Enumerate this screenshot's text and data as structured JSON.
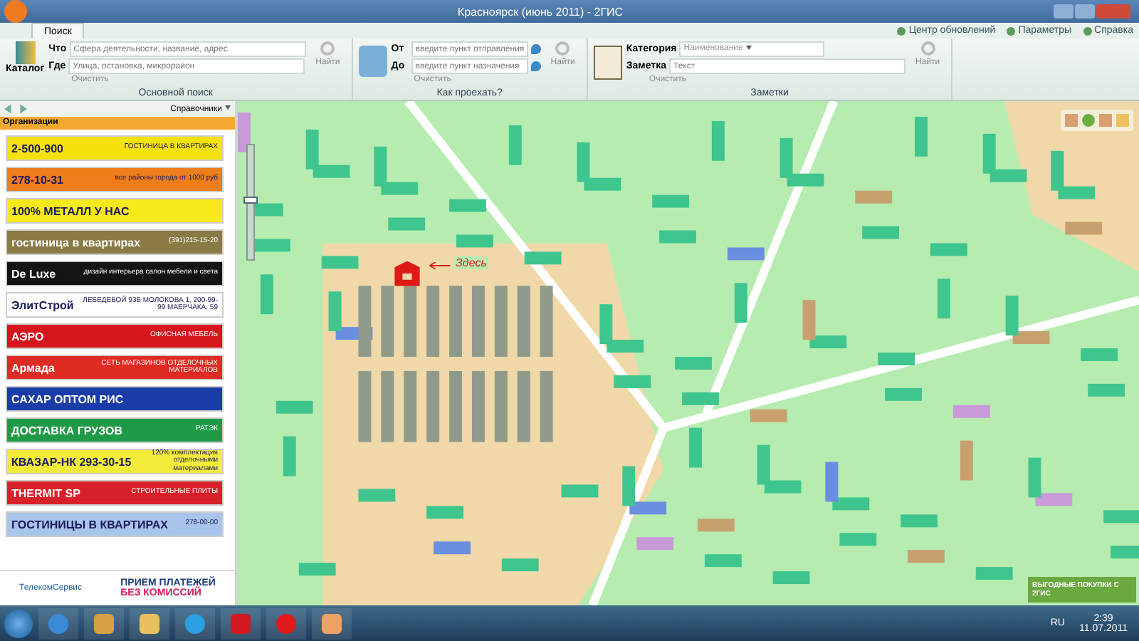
{
  "window": {
    "title": "Красноярск (июнь 2011) - 2ГИС"
  },
  "toolbar_links": [
    "Центр обновлений",
    "Параметры",
    "Справка"
  ],
  "tabs": [
    {
      "label": "Поиск",
      "selected": true
    }
  ],
  "ribbon": {
    "groups": [
      {
        "title": "Основной поиск",
        "big_button": "Каталог",
        "fields": [
          {
            "label": "Что",
            "placeholder": "Сфера деятельности, название, адрес",
            "kind": "input"
          },
          {
            "label": "Где",
            "placeholder": "Улица, остановка, микрорайон",
            "kind": "input"
          }
        ],
        "clear": "Очистить",
        "find": "Найти"
      },
      {
        "title": "Как проехать?",
        "fields": [
          {
            "label": "От",
            "placeholder": "введите пункт отправления",
            "kind": "route"
          },
          {
            "label": "До",
            "placeholder": "введите пункт назначения",
            "kind": "route"
          }
        ],
        "clear": "Очистить",
        "find": "Найти"
      },
      {
        "title": "Заметки",
        "fields": [
          {
            "label": "Категория",
            "placeholder": "Наименование",
            "kind": "select"
          },
          {
            "label": "Заметка",
            "placeholder": "Текст",
            "kind": "input"
          }
        ],
        "clear": "Очистить",
        "find": "Найти"
      }
    ]
  },
  "sidebar": {
    "dropdown": "Справочники",
    "header": "Организации",
    "ads": [
      {
        "headline": "2-500-900",
        "subline": "ГОСТИНИЦА В КВАРТИРАХ",
        "color": "#f5e20a"
      },
      {
        "headline": "278-10-31",
        "subline": "все районы города от 1000 руб",
        "color": "#ee7d1c"
      },
      {
        "headline": "100% МЕТАЛЛ У НАС",
        "color": "#f7ea1a"
      },
      {
        "headline": "гостиница в квартирах",
        "subline": "(391)215-15-20",
        "color": "#8a7a44"
      },
      {
        "headline": "De Luxe",
        "subline": "дизайн интерьера салон мебели и света",
        "color": "#141414"
      },
      {
        "headline": "ЭлитСтрой",
        "subline": "ЛЕБЕДЕВОЙ 93Б МОЛОКОВА 1, 200-99-99 МАЕРЧАКА, 59",
        "color": "#ffffff"
      },
      {
        "headline": "АЭРО",
        "subline": "ОФИСНАЯ МЕБЕЛЬ",
        "color": "#d8141c"
      },
      {
        "headline": "Армада",
        "subline": "СЕТЬ МАГАЗИНОВ ОТДЕЛОЧНЫХ МАТЕРИАЛОВ",
        "color": "#e02a24"
      },
      {
        "headline": "САХАР ОПТОМ РИС",
        "color": "#1a3ca8"
      },
      {
        "headline": "ДОСТАВКА ГРУЗОВ",
        "subline": "РАТЭК",
        "color": "#1f9a46"
      },
      {
        "headline": "КВАЗАР-НК 293-30-15",
        "subline": "120% комплектация отделочными материалами",
        "color": "#f4ec3a"
      },
      {
        "headline": "THERMIT SP",
        "subline": "СТРОИТЕЛЬНЫЕ ПЛИТЫ",
        "color": "#d8202a"
      },
      {
        "headline": "ГОСТИНИЦЫ В КВАРТИРАХ",
        "subline": "278-00-00",
        "color": "#a8c4ea"
      }
    ],
    "bottom_ad": {
      "brand": "ТелекомСервис",
      "headline": "ПРИЕМ ПЛАТЕЖЕЙ",
      "subline": "БЕЗ КОМИССИЙ"
    }
  },
  "map": {
    "marker_label": "Здесь",
    "promo": "ВЫГОДНЫЕ ПОКУПКИ С 2ГИС",
    "zoom": {
      "level": 0.55
    }
  },
  "taskbar": {
    "language": "RU",
    "time": "2:39",
    "date": "11.07.2011"
  }
}
